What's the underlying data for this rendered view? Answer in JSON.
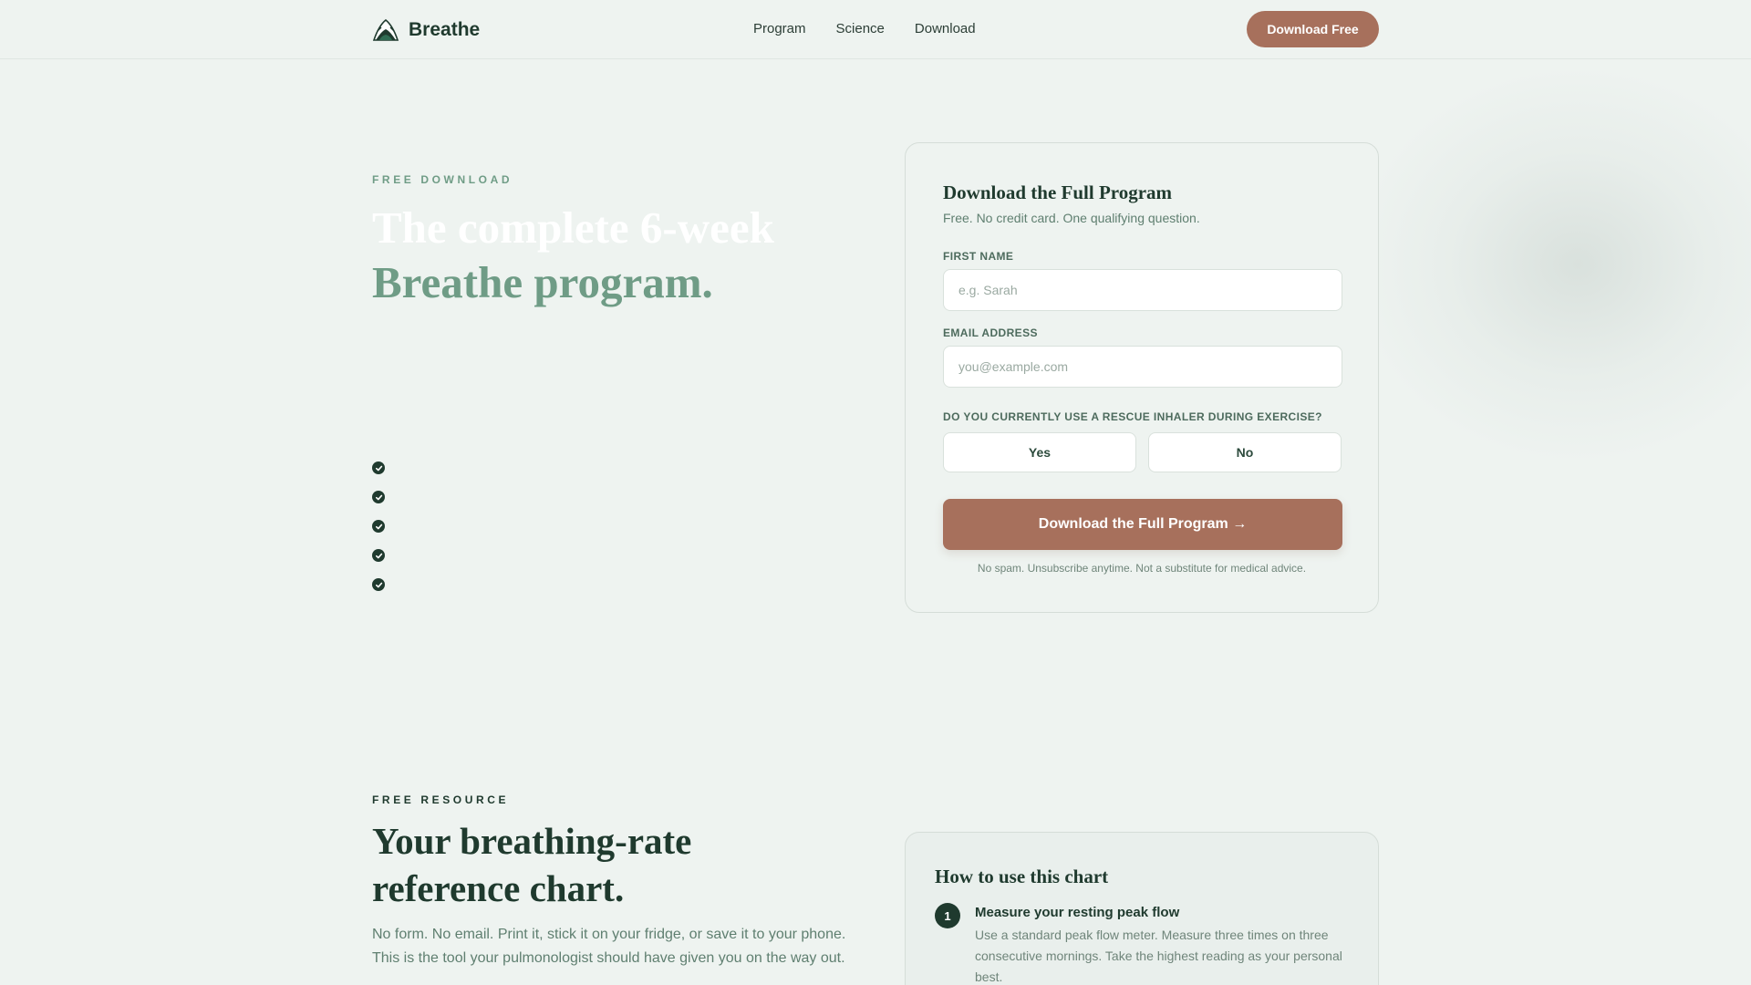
{
  "nav": {
    "brand": "Breathe",
    "links": [
      "Program",
      "Science",
      "Download"
    ],
    "cta": "Download Free"
  },
  "hero": {
    "eyebrow": "FREE DOWNLOAD",
    "title_line1": "The complete 6-week",
    "title_line2": "Breathe program.",
    "checklist_count": 5
  },
  "form": {
    "title": "Download the Full Program",
    "subtitle": "Free. No credit card. One qualifying question.",
    "first_name_label": "FIRST NAME",
    "first_name_placeholder": "e.g. Sarah",
    "email_label": "EMAIL ADDRESS",
    "email_placeholder": "you@example.com",
    "question": "DO YOU CURRENTLY USE A RESCUE INHALER DURING EXERCISE?",
    "yes": "Yes",
    "no": "No",
    "submit": "Download the Full Program →",
    "disclaimer": "No spam. Unsubscribe anytime. Not a substitute for medical advice."
  },
  "resource": {
    "eyebrow": "FREE RESOURCE",
    "title": "Your breathing-rate reference chart.",
    "description": "No form. No email. Print it, stick it on your fridge, or save it to your phone. This is the tool your pulmonologist should have given you on the way out."
  },
  "howto": {
    "title": "How to use this chart",
    "steps": [
      {
        "number": "1",
        "title": "Measure your resting peak flow",
        "description": "Use a standard peak flow meter. Measure three times on three consecutive mornings. Take the highest reading as your personal best."
      }
    ]
  },
  "colors": {
    "background": "#eef3f0",
    "accent": "#a7705c",
    "dark_green": "#1f3a2e",
    "sage": "#6f9c86"
  }
}
